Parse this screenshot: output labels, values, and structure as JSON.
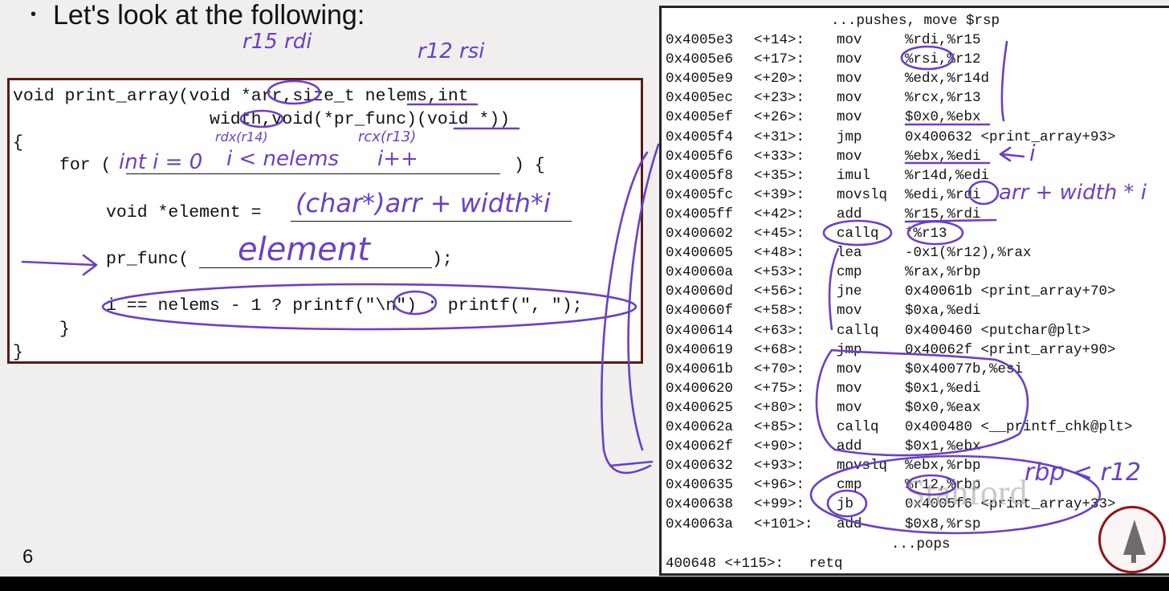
{
  "slide": {
    "bullet_glyph": "•",
    "heading": "Let's look at the following:",
    "number": "6"
  },
  "code": {
    "line1": "void print_array(void *arr,size_t nelems,int",
    "line2": "width,void(*pr_func)(void *))",
    "line3": "{",
    "line4_prefix": "for (",
    "line4_suffix": ") {",
    "line5_prefix": "void *element =",
    "line6_prefix": "pr_func(",
    "line6_suffix": ");",
    "line7": "i == nelems - 1 ? printf(\"\\n\") : printf(\", \");",
    "line8": "}",
    "line9": "}"
  },
  "assembly": {
    "header": "...pushes, move $rsp",
    "rows": [
      {
        "addr": "0x4005e3",
        "off": "<+14>:",
        "instr": "mov",
        "ops": "%rdi,%r15"
      },
      {
        "addr": "0x4005e6",
        "off": "<+17>:",
        "instr": "mov",
        "ops": "%rsi,%r12"
      },
      {
        "addr": "0x4005e9",
        "off": "<+20>:",
        "instr": "mov",
        "ops": "%edx,%r14d"
      },
      {
        "addr": "0x4005ec",
        "off": "<+23>:",
        "instr": "mov",
        "ops": "%rcx,%r13"
      },
      {
        "addr": "0x4005ef",
        "off": "<+26>:",
        "instr": "mov",
        "ops": "$0x0,%ebx"
      },
      {
        "addr": "0x4005f4",
        "off": "<+31>:",
        "instr": "jmp",
        "ops": "0x400632 <print_array+93>"
      },
      {
        "addr": "0x4005f6",
        "off": "<+33>:",
        "instr": "mov",
        "ops": "%ebx,%edi"
      },
      {
        "addr": "0x4005f8",
        "off": "<+35>:",
        "instr": "imul",
        "ops": "%r14d,%edi"
      },
      {
        "addr": "0x4005fc",
        "off": "<+39>:",
        "instr": "movslq",
        "ops": "%edi,%rdi"
      },
      {
        "addr": "0x4005ff",
        "off": "<+42>:",
        "instr": "add",
        "ops": "%r15,%rdi"
      },
      {
        "addr": "0x400602",
        "off": "<+45>:",
        "instr": "callq",
        "ops": "*%r13"
      },
      {
        "addr": "0x400605",
        "off": "<+48>:",
        "instr": "lea",
        "ops": "-0x1(%r12),%rax"
      },
      {
        "addr": "0x40060a",
        "off": "<+53>:",
        "instr": "cmp",
        "ops": "%rax,%rbp"
      },
      {
        "addr": "0x40060d",
        "off": "<+56>:",
        "instr": "jne",
        "ops": "0x40061b <print_array+70>"
      },
      {
        "addr": "0x40060f",
        "off": "<+58>:",
        "instr": "mov",
        "ops": "$0xa,%edi"
      },
      {
        "addr": "0x400614",
        "off": "<+63>:",
        "instr": "callq",
        "ops": "0x400460 <putchar@plt>"
      },
      {
        "addr": "0x400619",
        "off": "<+68>:",
        "instr": "jmp",
        "ops": "0x40062f <print_array+90>"
      },
      {
        "addr": "0x40061b",
        "off": "<+70>:",
        "instr": "mov",
        "ops": "$0x40077b,%esi"
      },
      {
        "addr": "0x400620",
        "off": "<+75>:",
        "instr": "mov",
        "ops": "$0x1,%edi"
      },
      {
        "addr": "0x400625",
        "off": "<+80>:",
        "instr": "mov",
        "ops": "$0x0,%eax"
      },
      {
        "addr": "0x40062a",
        "off": "<+85>:",
        "instr": "callq",
        "ops": "0x400480 <__printf_chk@plt>"
      },
      {
        "addr": "0x40062f",
        "off": "<+90>:",
        "instr": "add",
        "ops": "$0x1,%ebx"
      },
      {
        "addr": "0x400632",
        "off": "<+93>:",
        "instr": "movslq",
        "ops": "%ebx,%rbp"
      },
      {
        "addr": "0x400635",
        "off": "<+96>:",
        "instr": "cmp",
        "ops": "%r12,%rbp"
      },
      {
        "addr": "0x400638",
        "off": "<+99>:",
        "instr": "jb",
        "ops": "0x4005f6 <print_array+33>"
      },
      {
        "addr": "0x40063a",
        "off": "<+101>:",
        "instr": "add",
        "ops": "$0x8,%rsp"
      }
    ],
    "pops": "...pops",
    "last_line": "400648 <+115>:   retq"
  },
  "annotations": {
    "ink_color": "#6b3fc4",
    "arr_note": "r15 rdi",
    "nelems_note": "r12 rsi",
    "width_note": "rdx(r14)",
    "pr_func_note": "rcx(r13)",
    "for_init": "int i = 0",
    "for_cond": "i < nelems",
    "for_incr": "i++",
    "element_expr": "(char*)arr + width*i",
    "pr_func_arg": "element",
    "edi_note": "i",
    "rdi_note": "arr + width * i",
    "rbp_note": "rbp < r12"
  },
  "watermark": "Stanford"
}
